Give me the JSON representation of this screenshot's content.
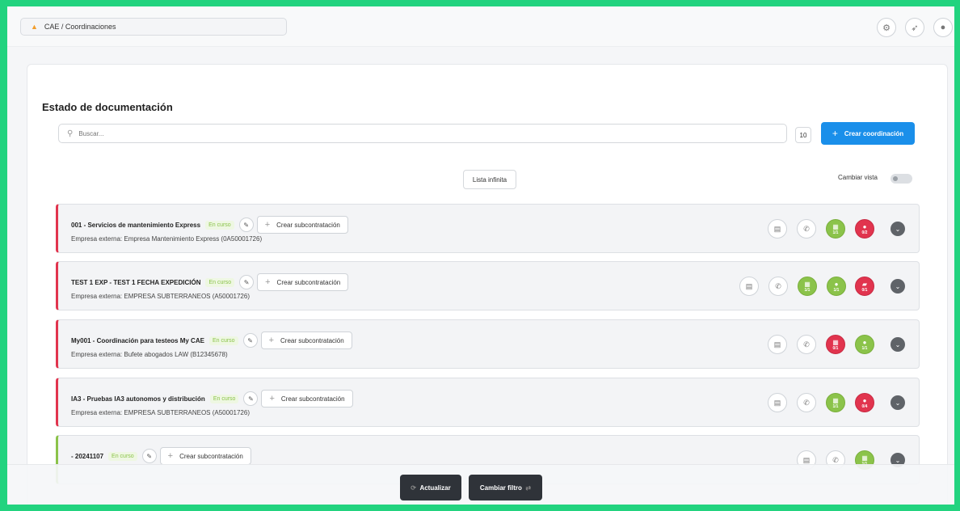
{
  "breadcrumb": "CAE / Coordinaciones",
  "title": "Estado de documentación",
  "search": {
    "placeholder": "Buscar..."
  },
  "page_size": "10",
  "create_button": "Crear coordinación",
  "list_mode_button": "Lista infinita",
  "view_toggle_label": "Cambiar vista",
  "subcontract_label": "Crear subcontratación",
  "rows": [
    {
      "title": "001 - Servicios de mantenimiento Express",
      "status": "En curso",
      "company": "Empresa externa: Empresa Mantenimiento Express (0A50001726)",
      "badges": [
        {
          "icon": "documents-icon",
          "color": "green",
          "count": "1/1"
        },
        {
          "icon": "workers-icon",
          "color": "red",
          "count": "0/2"
        }
      ]
    },
    {
      "title": "TEST 1 EXP - TEST 1 FECHA EXPEDICIÓN",
      "status": "En curso",
      "company": "Empresa externa: EMPRESA SUBTERRANEOS (A50001726)",
      "badges": [
        {
          "icon": "documents-icon",
          "color": "green",
          "count": "1/1"
        },
        {
          "icon": "workers-icon",
          "color": "green",
          "count": "1/1"
        },
        {
          "icon": "vehicles-icon",
          "color": "red",
          "count": "0/1"
        }
      ]
    },
    {
      "title": "My001 - Coordinación para testeos My CAE",
      "status": "En curso",
      "company": "Empresa externa: Bufete abogados LAW (B12345678)",
      "badges": [
        {
          "icon": "documents-icon",
          "color": "red",
          "count": "0/1"
        },
        {
          "icon": "workers-icon",
          "color": "green",
          "count": "1/1"
        }
      ]
    },
    {
      "title": "IA3 - Pruebas IA3 autonomos y distribución",
      "status": "En curso",
      "company": "Empresa externa: EMPRESA SUBTERRANEOS (A50001726)",
      "badges": [
        {
          "icon": "documents-icon",
          "color": "green",
          "count": "1/1"
        },
        {
          "icon": "workers-icon",
          "color": "red",
          "count": "0/4"
        }
      ]
    },
    {
      "title": "- 20241107",
      "status": "En curso",
      "company": "",
      "badges": [
        {
          "icon": "documents-icon",
          "color": "green",
          "count": "1/1"
        }
      ]
    }
  ],
  "footer": {
    "refresh": "Actualizar",
    "change_filter": "Cambiar filtro"
  },
  "colors": {
    "accent": "#1a8fea",
    "danger": "#e1344e",
    "ok": "#8bc34a"
  }
}
